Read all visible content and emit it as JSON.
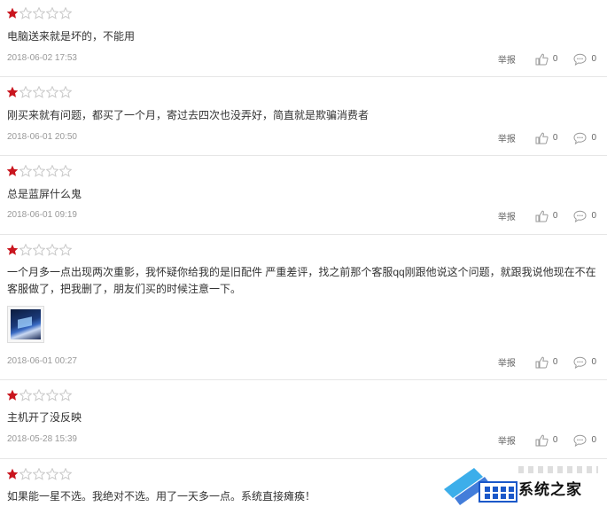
{
  "colors": {
    "star_filled": "#c9151e",
    "star_empty": "#c8c8c8",
    "date_text": "#999999",
    "divider": "#e6e6e6"
  },
  "labels": {
    "report": "举报",
    "like_count": "0",
    "comment_count": "0"
  },
  "icons": {
    "rating_filled": "star-filled-icon",
    "rating_empty": "star-empty-icon",
    "like": "thumbs-up-icon",
    "comment": "comment-bubble-icon"
  },
  "reviews": [
    {
      "rating": 1,
      "text": "电脑送来就是坏的，不能用",
      "date": "2018-06-02 17:53",
      "likes": "0",
      "comments": "0"
    },
    {
      "rating": 1,
      "text": "刚买来就有问题，都买了一个月，寄过去四次也没弄好，简直就是欺骗消费者",
      "date": "2018-06-01 20:50",
      "likes": "0",
      "comments": "0"
    },
    {
      "rating": 1,
      "text": "总是蓝屏什么鬼",
      "date": "2018-06-01 09:19",
      "likes": "0",
      "comments": "0"
    },
    {
      "rating": 1,
      "text": "一个月多一点出现两次重影，我怀疑你给我的是旧配件 严重差评，找之前那个客服qq刚跟他说这个问题，就跟我说他现在不在客服做了，把我删了，朋友们买的时候注意一下。",
      "date": "2018-06-01 00:27",
      "likes": "0",
      "comments": "0",
      "has_image": true
    },
    {
      "rating": 1,
      "text": "主机开了没反映",
      "date": "2018-05-28 15:39",
      "likes": "0",
      "comments": "0"
    },
    {
      "rating": 1,
      "text": "如果能一星不选。我绝对不选。用了一天多一点。系统直接瘫痪！",
      "date": "",
      "likes": "",
      "comments": ""
    }
  ],
  "watermark": {
    "text": "系统之家"
  }
}
